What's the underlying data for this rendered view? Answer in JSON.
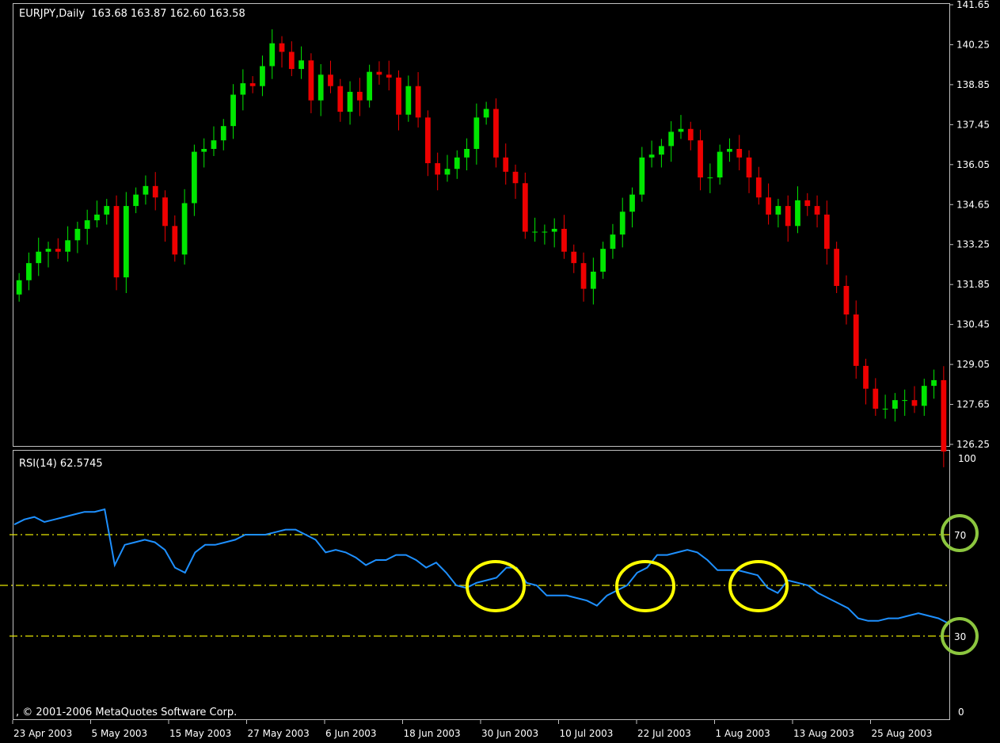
{
  "price_panel": {
    "header": "EURJPY,Daily  163.68 163.87 162.60 163.58"
  },
  "rsi_panel": {
    "header": "RSI(14) 62.5745"
  },
  "copyright": ", © 2001-2006 MetaQuotes Software Corp.",
  "colors": {
    "background": "#000000",
    "grid_border": "#c0c0c0",
    "bull": "#00e600",
    "bear": "#ee0000",
    "rsi_line": "#1e90ff",
    "level_line": "#e6e600",
    "highlight_yellow": "#ffff00",
    "highlight_green": "#8cc63f"
  },
  "chart_data": [
    {
      "type": "candlestick",
      "symbol": "EURJPY",
      "timeframe": "Daily",
      "ylim": [
        126.25,
        141.65
      ],
      "y_ticks": [
        "141.65",
        "140.25",
        "138.85",
        "137.45",
        "136.05",
        "134.65",
        "133.25",
        "131.85",
        "130.45",
        "129.05",
        "127.65",
        "126.25"
      ],
      "x_ticks": [
        "23 Apr 2003",
        "5 May 2003",
        "15 May 2003",
        "27 May 2003",
        "6 Jun 2003",
        "18 Jun 2003",
        "30 Jun 2003",
        "10 Jul 2003",
        "22 Jul 2003",
        "1 Aug 2003",
        "13 Aug 2003",
        "25 Aug 2003"
      ],
      "close_path": [
        132.0,
        132.6,
        133.0,
        133.1,
        133.0,
        133.4,
        133.8,
        134.1,
        134.3,
        134.6,
        132.1,
        134.6,
        135.0,
        135.3,
        134.9,
        133.9,
        132.9,
        134.7,
        136.5,
        136.6,
        136.9,
        137.4,
        138.5,
        138.9,
        138.8,
        139.5,
        140.3,
        140.0,
        139.4,
        139.7,
        138.3,
        139.2,
        138.8,
        137.9,
        138.6,
        138.3,
        139.3,
        139.2,
        139.1,
        137.8,
        138.8,
        137.7,
        136.1,
        135.7,
        135.9,
        136.3,
        136.6,
        137.7,
        138.0,
        136.3,
        135.8,
        135.4,
        133.7,
        133.7,
        133.7,
        133.8,
        133.0,
        132.6,
        131.7,
        132.3,
        133.1,
        133.6,
        134.4,
        135.0,
        136.3,
        136.4,
        136.7,
        137.2,
        137.3,
        136.9,
        135.6,
        135.6,
        136.5,
        136.6,
        136.3,
        135.6,
        134.9,
        134.3,
        134.6,
        133.9,
        134.8,
        134.6,
        134.3,
        133.1,
        131.8,
        130.8,
        129.0,
        128.2,
        127.5,
        127.5,
        127.8,
        127.8,
        127.6,
        128.3,
        128.5,
        126.0
      ]
    },
    {
      "type": "line",
      "indicator": "RSI(14)",
      "ylim": [
        0,
        100
      ],
      "y_ticks": [
        "100",
        "0"
      ],
      "levels": [
        70,
        30
      ],
      "level_labels": [
        "70",
        "30"
      ],
      "values": [
        74,
        76,
        77,
        75,
        76,
        77,
        78,
        79,
        79,
        80,
        58,
        66,
        67,
        68,
        67,
        64,
        57,
        55,
        63,
        66,
        66,
        67,
        68,
        70,
        70,
        70,
        71,
        72,
        72,
        70,
        68,
        63,
        64,
        63,
        61,
        58,
        60,
        60,
        62,
        62,
        60,
        57,
        59,
        55,
        50,
        49,
        51,
        52,
        53,
        57,
        57,
        51,
        50,
        46,
        46,
        46,
        45,
        44,
        42,
        46,
        48,
        50,
        55,
        57,
        62,
        62,
        63,
        64,
        63,
        60,
        56,
        56,
        56,
        55,
        54,
        49,
        47,
        52,
        51,
        50,
        47,
        45,
        43,
        41,
        37,
        36,
        36,
        37,
        37,
        38,
        39,
        38,
        37,
        35
      ]
    }
  ]
}
